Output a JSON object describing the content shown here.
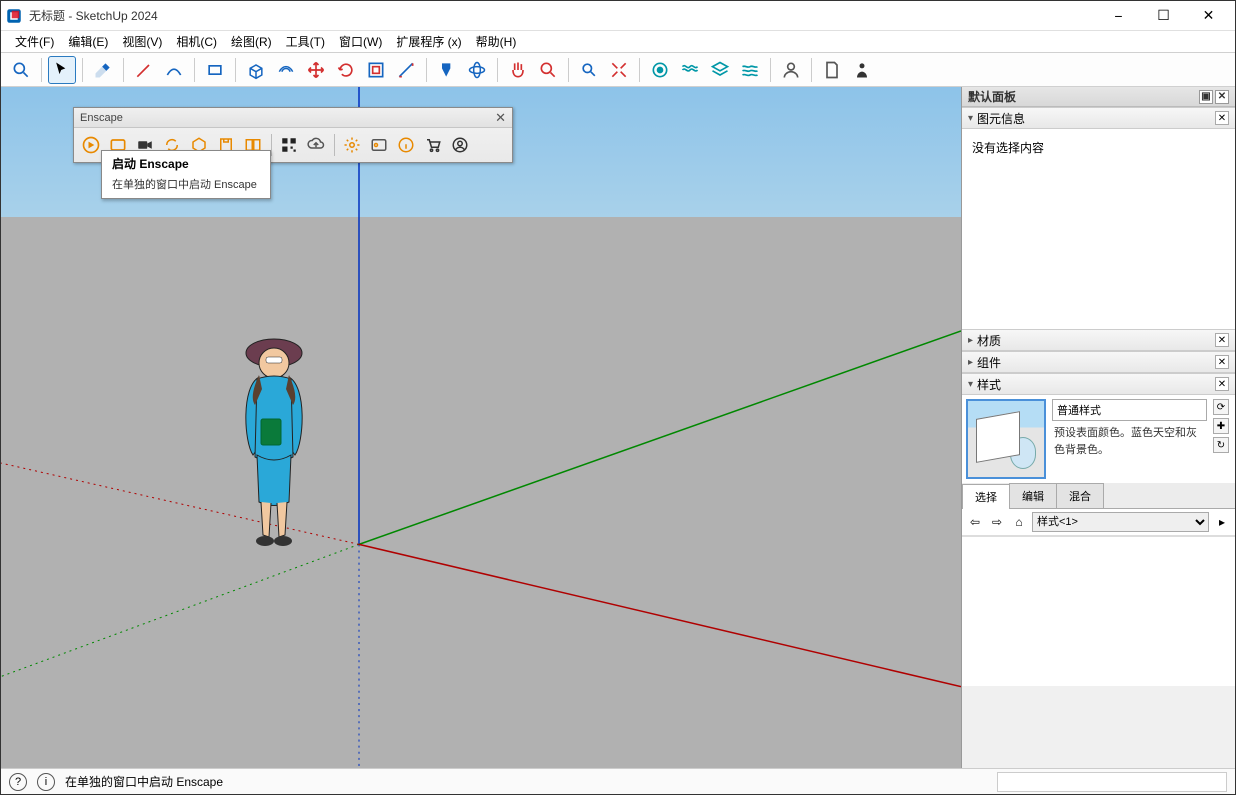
{
  "titlebar": {
    "title": "无标题 - SketchUp 2024"
  },
  "menu": {
    "file": "文件(F)",
    "edit": "编辑(E)",
    "view": "视图(V)",
    "camera": "相机(C)",
    "draw": "绘图(R)",
    "tools": "工具(T)",
    "window": "窗口(W)",
    "ext": "扩展程序 (x)",
    "help": "帮助(H)"
  },
  "enscape": {
    "title": "Enscape",
    "tooltip_title": "启动 Enscape",
    "tooltip_body": "在单独的窗口中启动 Enscape"
  },
  "tray": {
    "header": "默认面板",
    "entity": {
      "title": "图元信息",
      "empty": "没有选择内容"
    },
    "materials": {
      "title": "材质"
    },
    "components": {
      "title": "组件"
    },
    "styles": {
      "title": "样式",
      "name": "普通样式",
      "desc": "预设表面颜色。蓝色天空和灰色背景色。",
      "tabs": {
        "select": "选择",
        "edit": "编辑",
        "mix": "混合"
      },
      "dropdown": "样式<1>"
    }
  },
  "status": {
    "text": "在单独的窗口中启动 Enscape"
  }
}
